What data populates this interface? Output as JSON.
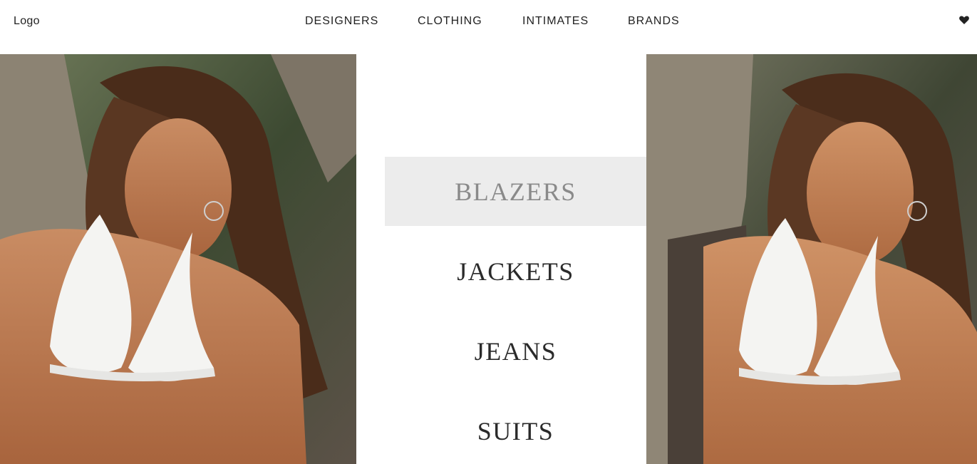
{
  "header": {
    "logo": "Logo",
    "nav": [
      "DESIGNERS",
      "CLOTHING",
      "INTIMATES",
      "BRANDS"
    ],
    "wishlist_icon": "heart-icon"
  },
  "menu": {
    "items": [
      "BLAZERS",
      "JACKETS",
      "JEANS",
      "SUITS"
    ],
    "active_index": 0
  },
  "colors": {
    "active_bg": "#ececec",
    "active_text": "#8a8a8a",
    "text": "#2a2a2a"
  }
}
